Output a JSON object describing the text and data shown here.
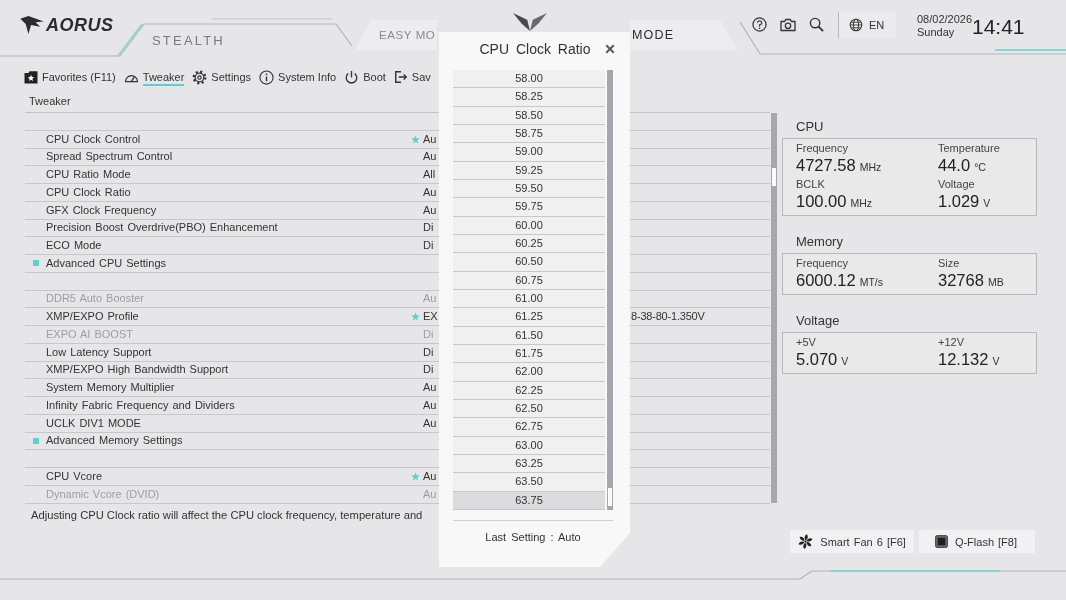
{
  "header": {
    "logo": "AORUS",
    "edition": "STEALTH",
    "mode_tabs": [
      {
        "label": "EASY MO",
        "selected": false
      },
      {
        "label": "MODE",
        "selected": true
      }
    ],
    "language": "EN",
    "date": "08/02/2026",
    "weekday": "Sunday",
    "time": "14:41"
  },
  "nav": {
    "items": [
      {
        "label": "Favorites (F11)",
        "selected": false
      },
      {
        "label": "Tweaker",
        "selected": true
      },
      {
        "label": "Settings",
        "selected": false
      },
      {
        "label": "System Info",
        "selected": false
      },
      {
        "label": "Boot",
        "selected": false
      },
      {
        "label": "Sav",
        "selected": false
      }
    ]
  },
  "settings": {
    "breadcrumb": "Tweaker",
    "sections": [
      {
        "rows": [
          {
            "kind": "setting",
            "label": "CPU Clock Control",
            "value": "Au",
            "favorite": true,
            "disabled": false
          },
          {
            "kind": "setting",
            "label": "Spread Spectrum Control",
            "value": "Au",
            "favorite": false,
            "disabled": false
          },
          {
            "kind": "setting",
            "label": "CPU Ratio Mode",
            "value": "All",
            "favorite": false,
            "disabled": false
          },
          {
            "kind": "setting",
            "label": "CPU Clock Ratio",
            "value": "Au",
            "favorite": false,
            "disabled": false
          },
          {
            "kind": "setting",
            "label": "GFX Clock Frequency",
            "value": "Au",
            "favorite": false,
            "disabled": false
          },
          {
            "kind": "setting",
            "label": "Precision Boost Overdrive(PBO) Enhancement",
            "value": "Di",
            "favorite": false,
            "disabled": false
          },
          {
            "kind": "setting",
            "label": "ECO Mode",
            "value": "Di",
            "favorite": false,
            "disabled": false
          },
          {
            "kind": "submenu",
            "label": "Advanced CPU Settings"
          }
        ]
      },
      {
        "rows": [
          {
            "kind": "setting",
            "label": "DDR5 Auto Booster",
            "value": "Au",
            "favorite": false,
            "disabled": true
          },
          {
            "kind": "setting",
            "label": "XMP/EXPO Profile",
            "value": "EX",
            "value_end": "8-38-80-1.350V",
            "favorite": true,
            "disabled": false
          },
          {
            "kind": "setting",
            "label": "EXPO AI BOOST",
            "value": "Di",
            "favorite": false,
            "disabled": true
          },
          {
            "kind": "setting",
            "label": "Low Latency Support",
            "value": "Di",
            "favorite": false,
            "disabled": false
          },
          {
            "kind": "setting",
            "label": "XMP/EXPO High Bandwidth Support",
            "value": "Di",
            "favorite": false,
            "disabled": false
          },
          {
            "kind": "setting",
            "label": "System Memory Multiplier",
            "value": "Au",
            "favorite": false,
            "disabled": false
          },
          {
            "kind": "setting",
            "label": "Infinity Fabric Frequency and Dividers",
            "value": "Au",
            "favorite": false,
            "disabled": false
          },
          {
            "kind": "setting",
            "label": "UCLK DIV1 MODE",
            "value": "Au",
            "favorite": false,
            "disabled": false
          },
          {
            "kind": "submenu",
            "label": "Advanced Memory Settings"
          }
        ]
      },
      {
        "rows": [
          {
            "kind": "setting",
            "label": "CPU Vcore",
            "value": "Au",
            "favorite": true,
            "disabled": false
          },
          {
            "kind": "setting",
            "label": "Dynamic Vcore (DVID)",
            "value": "Au",
            "favorite": false,
            "disabled": true
          }
        ]
      }
    ],
    "help_text": "Adjusting CPU Clock ratio will affect the CPU clock frequency, temperature and"
  },
  "monitor": {
    "groups": [
      {
        "title": "CPU",
        "readings": [
          {
            "label": "Frequency",
            "value": "4727.58",
            "unit": "MHz"
          },
          {
            "label": "Temperature",
            "value": "44.0",
            "unit": "°C"
          },
          {
            "label": "BCLK",
            "value": "100.00",
            "unit": "MHz"
          },
          {
            "label": "Voltage",
            "value": "1.029",
            "unit": "V"
          }
        ]
      },
      {
        "title": "Memory",
        "readings": [
          {
            "label": "Frequency",
            "value": "6000.12",
            "unit": "MT/s"
          },
          {
            "label": "Size",
            "value": "32768",
            "unit": "MB"
          }
        ]
      },
      {
        "title": "Voltage",
        "readings": [
          {
            "label": "+5V",
            "value": "5.070",
            "unit": "V"
          },
          {
            "label": "+12V",
            "value": "12.132",
            "unit": "V"
          }
        ]
      }
    ]
  },
  "shortcuts": [
    "Smart Fan 6 [F6]",
    "Q-Flash [F8]"
  ],
  "dialog": {
    "title": "CPU Clock Ratio",
    "options": [
      {
        "label": "58.00",
        "selected": false
      },
      {
        "label": "58.25",
        "selected": false
      },
      {
        "label": "58.50",
        "selected": false
      },
      {
        "label": "58.75",
        "selected": false
      },
      {
        "label": "59.00",
        "selected": false
      },
      {
        "label": "59.25",
        "selected": false
      },
      {
        "label": "59.50",
        "selected": false
      },
      {
        "label": "59.75",
        "selected": false
      },
      {
        "label": "60.00",
        "selected": false
      },
      {
        "label": "60.25",
        "selected": false
      },
      {
        "label": "60.50",
        "selected": false
      },
      {
        "label": "60.75",
        "selected": false
      },
      {
        "label": "61.00",
        "selected": false
      },
      {
        "label": "61.25",
        "selected": false
      },
      {
        "label": "61.50",
        "selected": false
      },
      {
        "label": "61.75",
        "selected": false
      },
      {
        "label": "62.00",
        "selected": false
      },
      {
        "label": "62.25",
        "selected": false
      },
      {
        "label": "62.50",
        "selected": false
      },
      {
        "label": "62.75",
        "selected": false
      },
      {
        "label": "63.00",
        "selected": false
      },
      {
        "label": "63.25",
        "selected": false
      },
      {
        "label": "63.50",
        "selected": false
      },
      {
        "label": "63.75",
        "selected": true
      }
    ],
    "footer": "Last Setting : Auto"
  }
}
